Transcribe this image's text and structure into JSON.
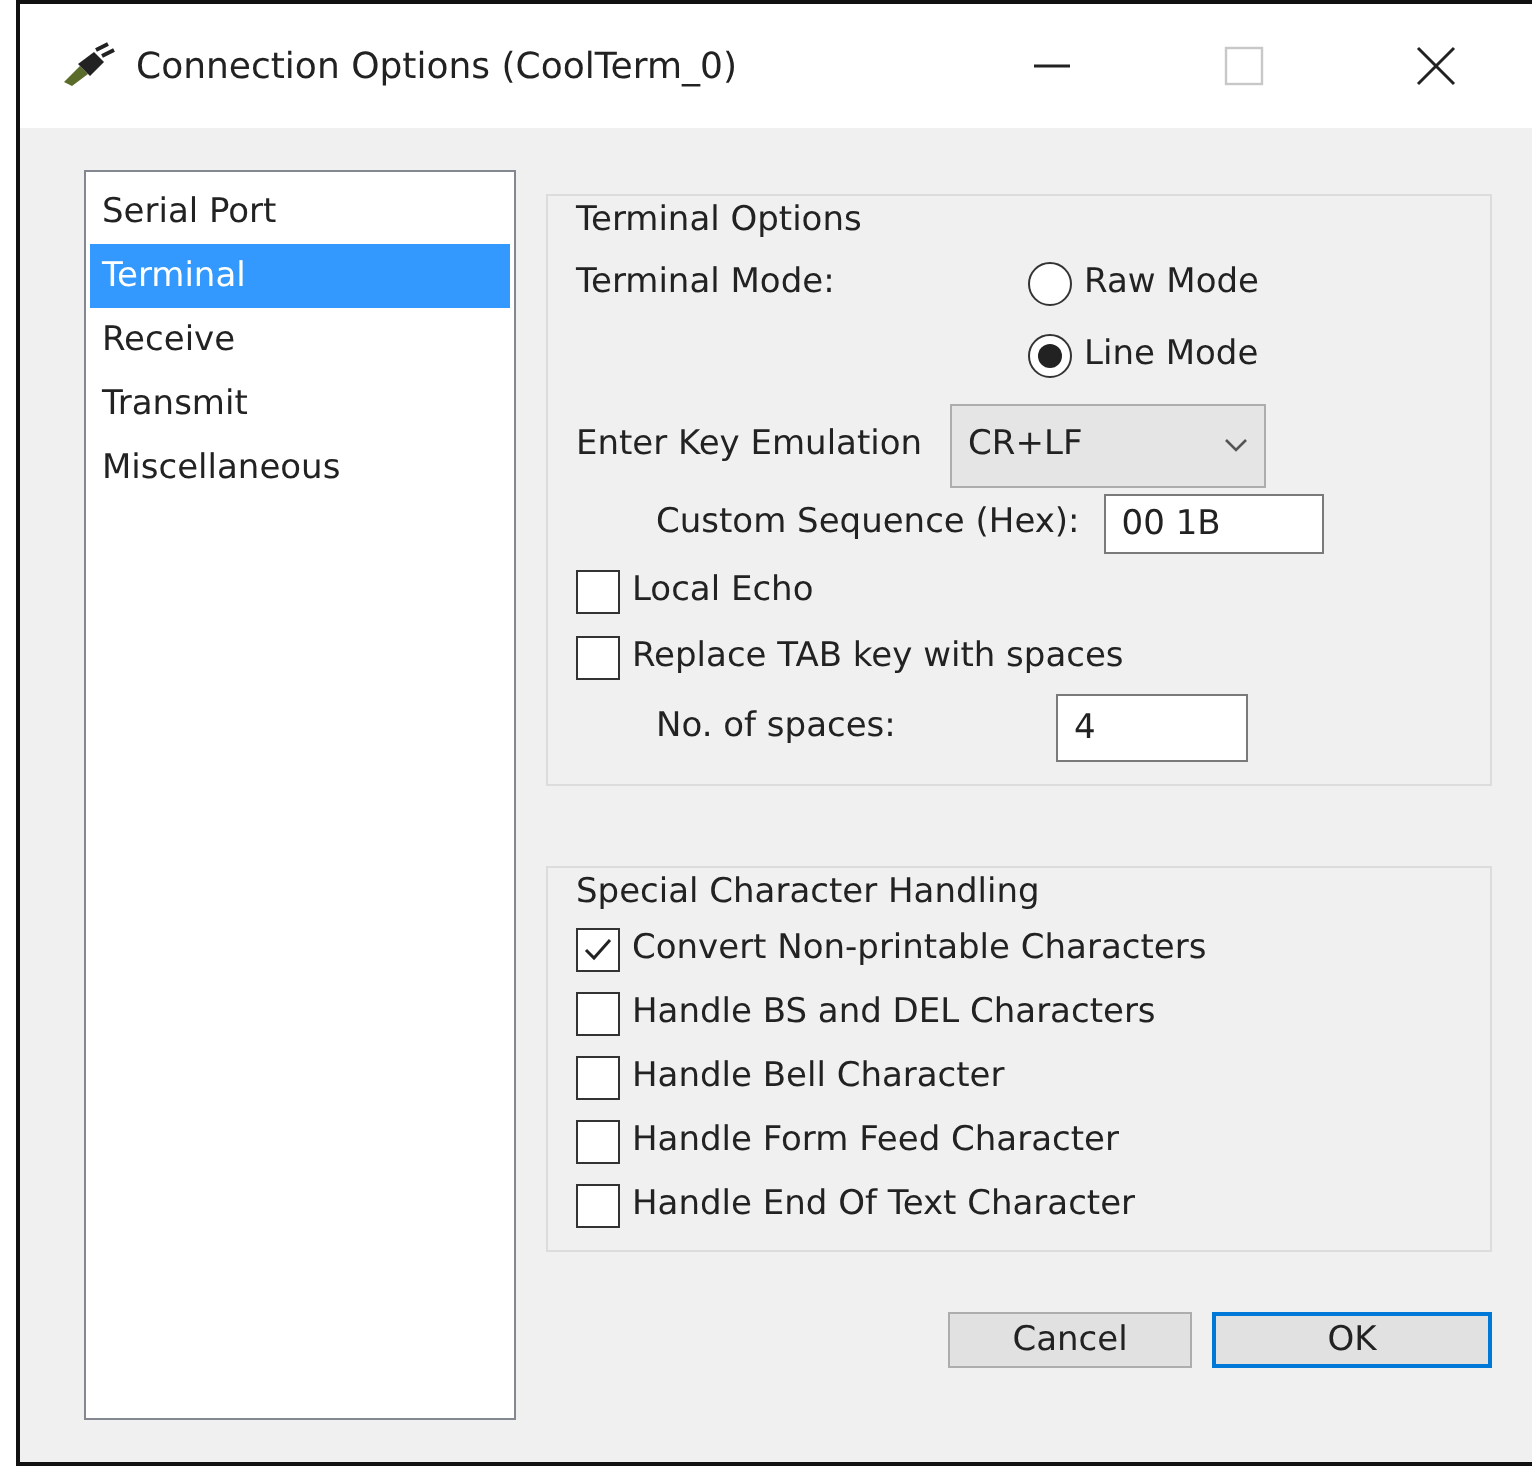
{
  "window": {
    "title": "Connection Options (CoolTerm_0)",
    "controls": [
      {
        "kind": "minimize",
        "disabled": false
      },
      {
        "kind": "maximize",
        "disabled": true
      },
      {
        "kind": "close",
        "disabled": false
      }
    ]
  },
  "sidebar": {
    "items": [
      {
        "label": "Serial Port",
        "selected": false
      },
      {
        "label": "Terminal",
        "selected": true
      },
      {
        "label": "Receive",
        "selected": false
      },
      {
        "label": "Transmit",
        "selected": false
      },
      {
        "label": "Miscellaneous",
        "selected": false
      }
    ]
  },
  "terminal_options": {
    "title": "Terminal Options",
    "mode_label": "Terminal Mode:",
    "modes": [
      {
        "label": "Raw Mode",
        "selected": false
      },
      {
        "label": "Line Mode",
        "selected": true
      }
    ],
    "enter_key_label": "Enter Key Emulation",
    "enter_key_value": "CR+LF",
    "custom_label": "Custom Sequence (Hex):",
    "custom_value": "00 1B",
    "checkboxes": [
      {
        "label": "Local Echo",
        "checked": false
      },
      {
        "label": "Replace TAB key with spaces",
        "checked": false
      }
    ],
    "spaces_label": "No. of spaces:",
    "spaces_value": "4"
  },
  "special": {
    "title": "Special Character Handling",
    "checkboxes": [
      {
        "label": "Convert Non-printable Characters",
        "checked": true
      },
      {
        "label": "Handle BS and DEL Characters",
        "checked": false
      },
      {
        "label": "Handle Bell Character",
        "checked": false
      },
      {
        "label": "Handle Form Feed Character",
        "checked": false
      },
      {
        "label": "Handle End Of Text Character",
        "checked": false
      }
    ]
  },
  "buttons": [
    {
      "label": "Cancel",
      "kind": "normal"
    },
    {
      "label": "OK",
      "kind": "default"
    }
  ]
}
